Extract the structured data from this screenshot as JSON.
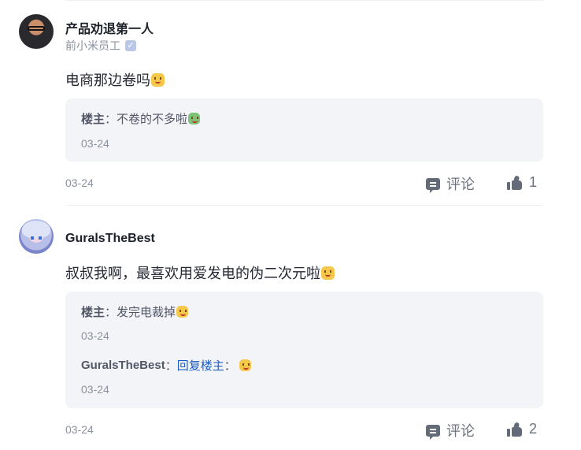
{
  "comments": [
    {
      "username": "产品劝退第一人",
      "subtitle": "前小米员工",
      "content": "电商那边卷吗",
      "replies": [
        {
          "author": "楼主",
          "separator": "：",
          "text": "不卷的不多啦",
          "date": "03-24"
        }
      ],
      "date": "03-24",
      "comment_label": "评论",
      "like_count": "1"
    },
    {
      "username": "GuralsTheBest",
      "content": "叔叔我啊，最喜欢用爱发电的伪二次元啦",
      "replies": [
        {
          "author": "楼主",
          "separator": "：",
          "text": "发完电裁掉",
          "date": "03-24"
        },
        {
          "author": "GuralsTheBest",
          "separator": "：",
          "link": "回复楼主",
          "separator2": "：",
          "date": "03-24"
        }
      ],
      "date": "03-24",
      "comment_label": "评论",
      "like_count": "2"
    }
  ],
  "icons": {
    "verified": "verified-badge-icon",
    "comment": "comment-icon",
    "like": "thumbs-up-icon",
    "emoji": "smile-emoji-icon"
  },
  "colors": {
    "link": "#1e5ec8",
    "reply_bg": "#f3f4f7",
    "meta": "#8a919f"
  }
}
